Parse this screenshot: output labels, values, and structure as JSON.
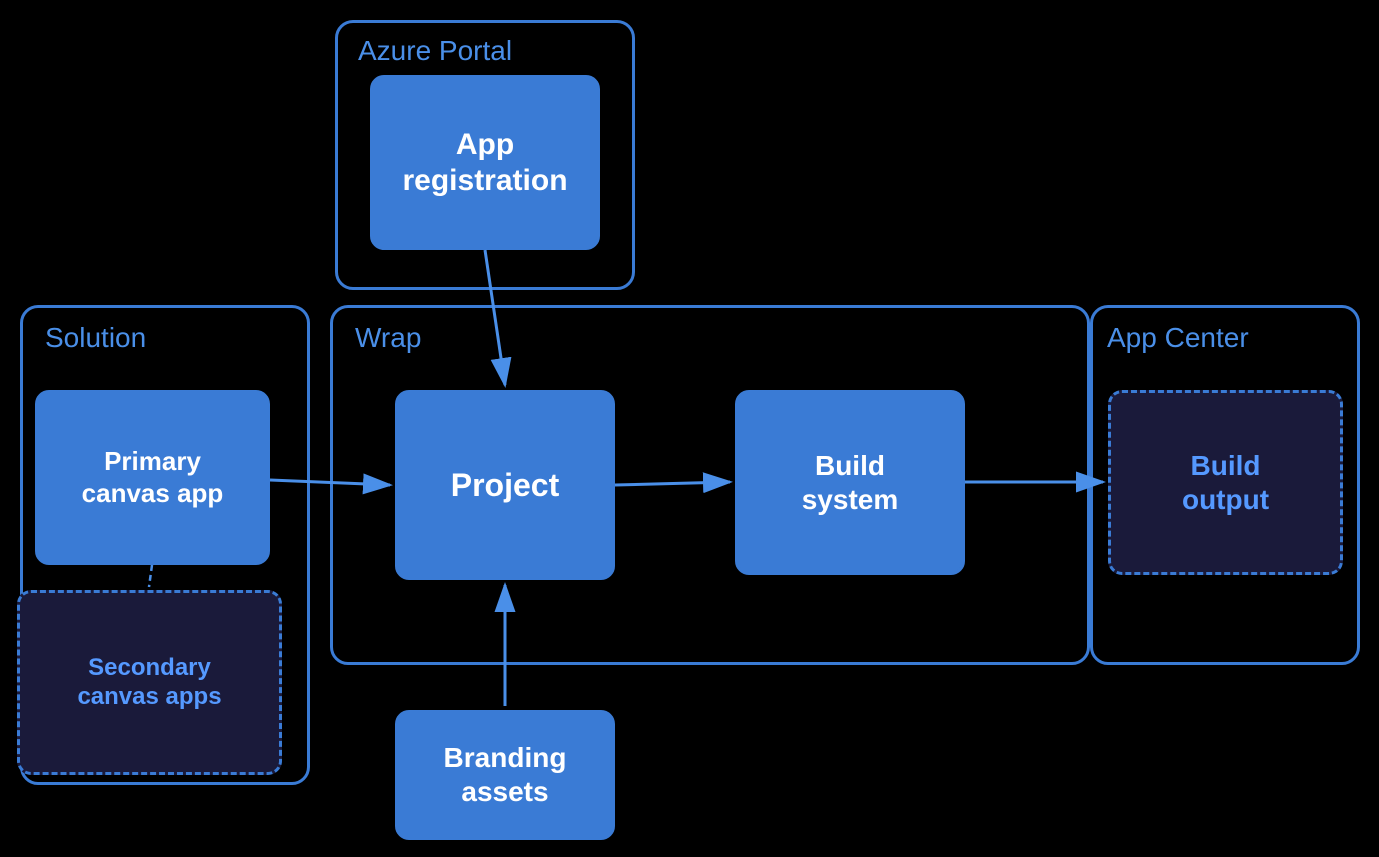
{
  "background": "#000000",
  "colors": {
    "blue_solid": "#3a7bd5",
    "blue_dashed": "#4a8fe8",
    "white": "#ffffff"
  },
  "nodes": {
    "azure_portal": {
      "label": "Azure Portal",
      "container_id": "azure-portal"
    },
    "app_registration": {
      "label": "App\nregistration",
      "id": "app-registration"
    },
    "solution": {
      "label": "Solution",
      "container_id": "solution"
    },
    "primary_canvas": {
      "label": "Primary\ncanvas app",
      "id": "primary-canvas"
    },
    "secondary_canvas": {
      "label": "Secondary\ncanvas apps",
      "id": "secondary-canvas"
    },
    "wrap": {
      "label": "Wrap",
      "container_id": "wrap"
    },
    "project": {
      "label": "Project",
      "id": "project"
    },
    "build_system": {
      "label": "Build\nsystem",
      "id": "build-system"
    },
    "app_center": {
      "label": "App Center",
      "container_id": "app-center"
    },
    "build_output": {
      "label": "Build\noutput",
      "id": "build-output"
    },
    "branding_assets": {
      "label": "Branding\nassets",
      "id": "branding-assets"
    }
  }
}
